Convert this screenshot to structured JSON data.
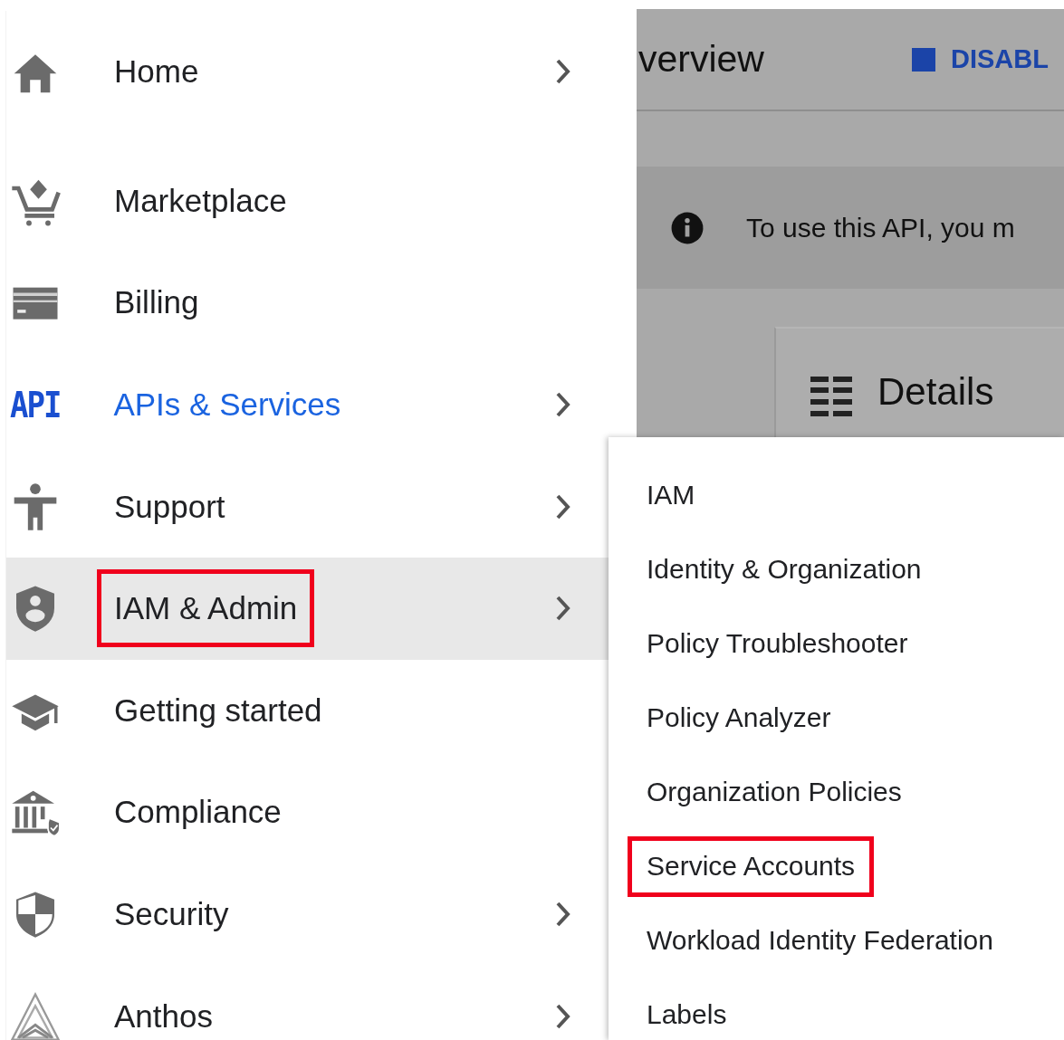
{
  "nav": {
    "items": [
      {
        "label": "Home",
        "chevron": true,
        "current": false,
        "expanded": false,
        "highlighted": false
      },
      {
        "label": "Marketplace",
        "chevron": false,
        "current": false,
        "expanded": false,
        "highlighted": false
      },
      {
        "label": "Billing",
        "chevron": false,
        "current": false,
        "expanded": false,
        "highlighted": false
      },
      {
        "label": "APIs & Services",
        "icon_text": "API",
        "chevron": true,
        "current": true,
        "expanded": false,
        "highlighted": false
      },
      {
        "label": "Support",
        "chevron": true,
        "current": false,
        "expanded": false,
        "highlighted": false
      },
      {
        "label": "IAM & Admin",
        "chevron": true,
        "current": false,
        "expanded": true,
        "highlighted": true
      },
      {
        "label": "Getting started",
        "chevron": false,
        "current": false,
        "expanded": false,
        "highlighted": false
      },
      {
        "label": "Compliance",
        "chevron": false,
        "current": false,
        "expanded": false,
        "highlighted": false
      },
      {
        "label": "Security",
        "chevron": true,
        "current": false,
        "expanded": false,
        "highlighted": false
      },
      {
        "label": "Anthos",
        "chevron": true,
        "current": false,
        "expanded": false,
        "highlighted": false
      }
    ]
  },
  "background_page": {
    "title": "verview",
    "action": "DISABL",
    "banner": "To use this API, you m",
    "card_title": "Details"
  },
  "submenu": {
    "items": [
      {
        "label": "IAM",
        "highlighted": false
      },
      {
        "label": "Identity & Organization",
        "highlighted": false
      },
      {
        "label": "Policy Troubleshooter",
        "highlighted": false
      },
      {
        "label": "Policy Analyzer",
        "highlighted": false
      },
      {
        "label": "Organization Policies",
        "highlighted": false
      },
      {
        "label": "Service Accounts",
        "highlighted": true
      },
      {
        "label": "Workload Identity Federation",
        "highlighted": false
      },
      {
        "label": "Labels",
        "highlighted": false
      }
    ]
  }
}
